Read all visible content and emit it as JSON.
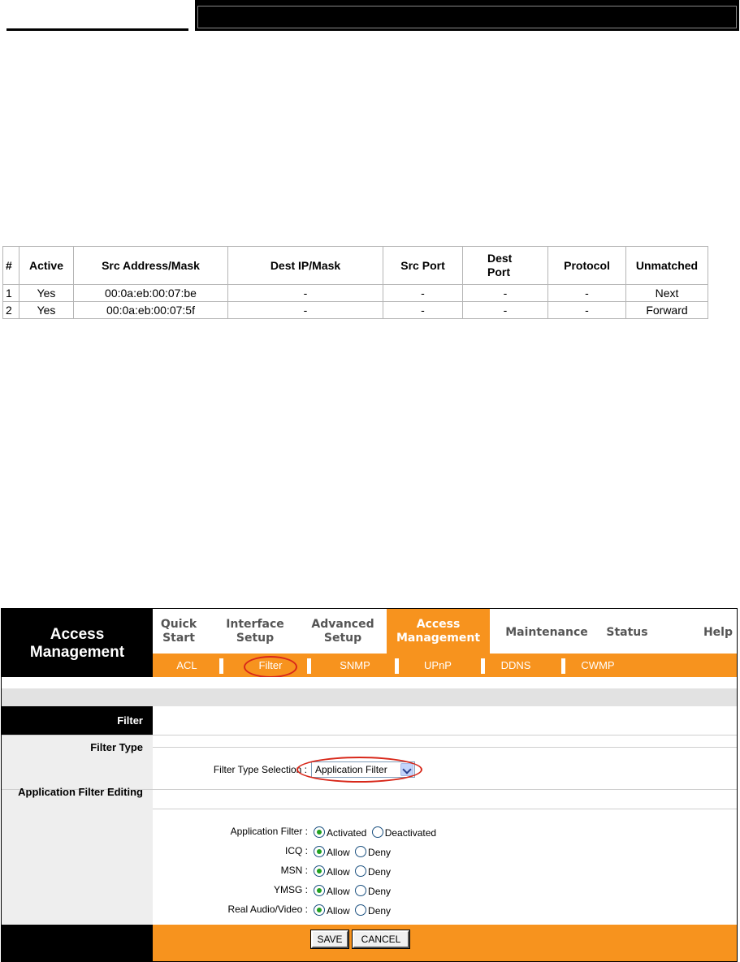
{
  "acl_table": {
    "headers": [
      "#",
      "Active",
      "Src Address/Mask",
      "Dest IP/Mask",
      "Src Port",
      "Dest Port",
      "Protocol",
      "Unmatched"
    ],
    "rows": [
      [
        "1",
        "Yes",
        "00:0a:eb:00:07:be",
        "-",
        "-",
        "-",
        "-",
        "Next"
      ],
      [
        "2",
        "Yes",
        "00:0a:eb:00:07:5f",
        "-",
        "-",
        "-",
        "-",
        "Forward"
      ]
    ]
  },
  "router": {
    "section_title": "Access Management",
    "nav": [
      {
        "label_1": "Quick",
        "label_2": "Start"
      },
      {
        "label_1": "Interface",
        "label_2": "Setup"
      },
      {
        "label_1": "Advanced",
        "label_2": "Setup"
      },
      {
        "label_1": "Access",
        "label_2": "Management",
        "active": true
      },
      {
        "label_1": "Maintenance",
        "label_2": ""
      },
      {
        "label_1": "Status",
        "label_2": ""
      },
      {
        "label_1": "Help",
        "label_2": ""
      }
    ],
    "subnav": [
      "ACL",
      "Filter",
      "SNMP",
      "UPnP",
      "DDNS",
      "CWMP"
    ],
    "filter_heading": "Filter",
    "filter_type_label": "Filter Type",
    "filter_type_selection_label": "Filter Type Selection :",
    "filter_type_value": "Application Filter",
    "app_filter_editing_label": "Application Filter Editing",
    "options": [
      {
        "label": "Application Filter :",
        "on": "Activated",
        "off": "Deactivated"
      },
      {
        "label": "ICQ :",
        "on": "Allow",
        "off": "Deny"
      },
      {
        "label": "MSN :",
        "on": "Allow",
        "off": "Deny"
      },
      {
        "label": "YMSG :",
        "on": "Allow",
        "off": "Deny"
      },
      {
        "label": "Real Audio/Video :",
        "on": "Allow",
        "off": "Deny"
      }
    ],
    "save_label": "SAVE",
    "cancel_label": "CANCEL",
    "colors": {
      "accent": "#f7931e",
      "highlight": "#d8281a"
    }
  }
}
